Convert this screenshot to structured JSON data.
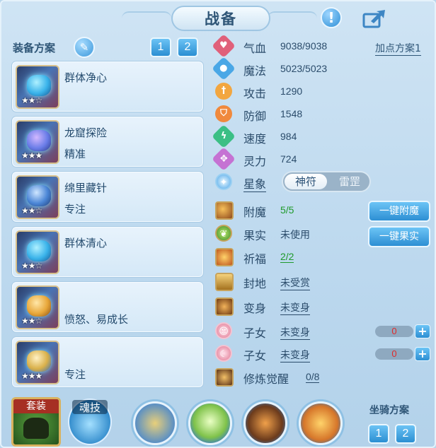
{
  "window": {
    "title": "战备"
  },
  "header": {
    "info_icon": "exclamation-icon",
    "share_icon": "share-icon"
  },
  "equipment": {
    "plan_label": "装备方案",
    "plan_tabs": [
      "1",
      "2"
    ],
    "items": [
      {
        "name": "群体净心",
        "sub": "",
        "stars": 2,
        "max_stars": 3
      },
      {
        "name": "龙窟探险",
        "sub": "精准",
        "stars": 3,
        "max_stars": 3
      },
      {
        "name": "绵里藏针",
        "sub": "专注",
        "stars": 2,
        "max_stars": 3
      },
      {
        "name": "群体清心",
        "sub": "",
        "stars": 2,
        "max_stars": 3
      },
      {
        "name": "",
        "sub": "愤怒、易成长",
        "stars": 2,
        "max_stars": 3
      },
      {
        "name": "",
        "sub": "专注",
        "stars": 3,
        "max_stars": 3
      }
    ]
  },
  "stats": {
    "add_plan": "加点方案1",
    "rows": [
      {
        "name": "气血",
        "value": "9038/9038",
        "color": "#e0607a",
        "icon": "heart-icon"
      },
      {
        "name": "魔法",
        "value": "5023/5023",
        "color": "#4aa7e6",
        "icon": "mana-icon"
      },
      {
        "name": "攻击",
        "value": "1290",
        "color": "#f2a640",
        "icon": "sword-icon"
      },
      {
        "name": "防御",
        "value": "1548",
        "color": "#f0893d",
        "icon": "shield-icon"
      },
      {
        "name": "速度",
        "value": "984",
        "color": "#3bbf85",
        "icon": "speed-icon"
      },
      {
        "name": "灵力",
        "value": "724",
        "color": "#c572d3",
        "icon": "spirit-icon"
      }
    ]
  },
  "star_sign": {
    "label": "星象",
    "options": [
      "神符",
      "雷罡"
    ],
    "selected": "神符"
  },
  "enhancements": [
    {
      "name": "附魔",
      "value": "5/5"
    },
    {
      "name": "果实",
      "value": "未使用"
    },
    {
      "name": "祈福",
      "value": "2/2"
    },
    {
      "name": "封地",
      "value": "未受赏"
    },
    {
      "name": "变身",
      "value": "未变身"
    },
    {
      "name": "子女",
      "value": "未变身",
      "counter": "0"
    },
    {
      "name": "子女",
      "value": "未变身",
      "counter": "0"
    },
    {
      "name": "修炼觉醒",
      "value": "0/8"
    }
  ],
  "buttons": {
    "enchant_all": "一键附魔",
    "fruit_all": "一键果实"
  },
  "bottom": {
    "suit_label": "套装",
    "soul_label": "魂技",
    "mount_label": "坐骑方案",
    "mount_tabs": [
      "1",
      "2"
    ]
  }
}
